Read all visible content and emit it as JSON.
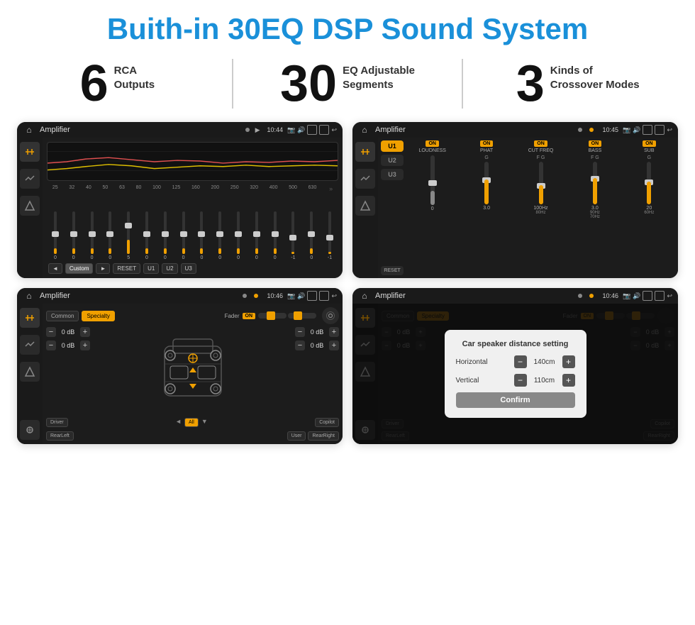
{
  "title": "Buith-in 30EQ DSP Sound System",
  "stats": [
    {
      "number": "6",
      "label1": "RCA",
      "label2": "Outputs"
    },
    {
      "number": "30",
      "label1": "EQ Adjustable",
      "label2": "Segments"
    },
    {
      "number": "3",
      "label1": "Kinds of",
      "label2": "Crossover Modes"
    }
  ],
  "screens": {
    "eq": {
      "status_bar": {
        "title": "Amplifier",
        "time": "10:44"
      },
      "freq_labels": [
        "25",
        "32",
        "40",
        "50",
        "63",
        "80",
        "100",
        "125",
        "160",
        "200",
        "250",
        "320",
        "400",
        "500",
        "630"
      ],
      "slider_values": [
        "0",
        "0",
        "0",
        "0",
        "5",
        "0",
        "0",
        "0",
        "0",
        "0",
        "0",
        "0",
        "0",
        "-1",
        "0",
        "-1"
      ],
      "bottom_buttons": [
        "◄",
        "Custom",
        "►",
        "RESET",
        "U1",
        "U2",
        "U3"
      ]
    },
    "crossover": {
      "status_bar": {
        "title": "Amplifier",
        "time": "10:45"
      },
      "presets": [
        "U1",
        "U2",
        "U3"
      ],
      "channels": [
        {
          "on": true,
          "label": "LOUDNESS"
        },
        {
          "on": true,
          "label": "PHAT"
        },
        {
          "on": true,
          "label": "CUT FREQ"
        },
        {
          "on": true,
          "label": "BASS"
        },
        {
          "on": true,
          "label": "SUB"
        }
      ],
      "reset_label": "RESET"
    },
    "fader": {
      "status_bar": {
        "title": "Amplifier",
        "time": "10:46"
      },
      "modes": [
        "Common",
        "Specialty"
      ],
      "fader_label": "Fader",
      "fader_on": "ON",
      "vol_rows": [
        {
          "label": "0 dB"
        },
        {
          "label": "0 dB"
        },
        {
          "label": "0 dB"
        },
        {
          "label": "0 dB"
        }
      ],
      "position_buttons": [
        "Driver",
        "RearLeft",
        "All",
        "User",
        "RearRight",
        "Copilot"
      ]
    },
    "dialog": {
      "status_bar": {
        "title": "Amplifier",
        "time": "10:46"
      },
      "modes": [
        "Common",
        "Specialty"
      ],
      "fader_on": "ON",
      "dialog": {
        "title": "Car speaker distance setting",
        "rows": [
          {
            "label": "Horizontal",
            "value": "140cm"
          },
          {
            "label": "Vertical",
            "value": "110cm"
          }
        ],
        "confirm_label": "Confirm"
      },
      "vol_rows": [
        {
          "label": "0 dB"
        },
        {
          "label": "0 dB"
        }
      ],
      "position_buttons": [
        "Driver",
        "RearLeft",
        "All",
        "Copilot",
        "RearRight"
      ]
    }
  }
}
